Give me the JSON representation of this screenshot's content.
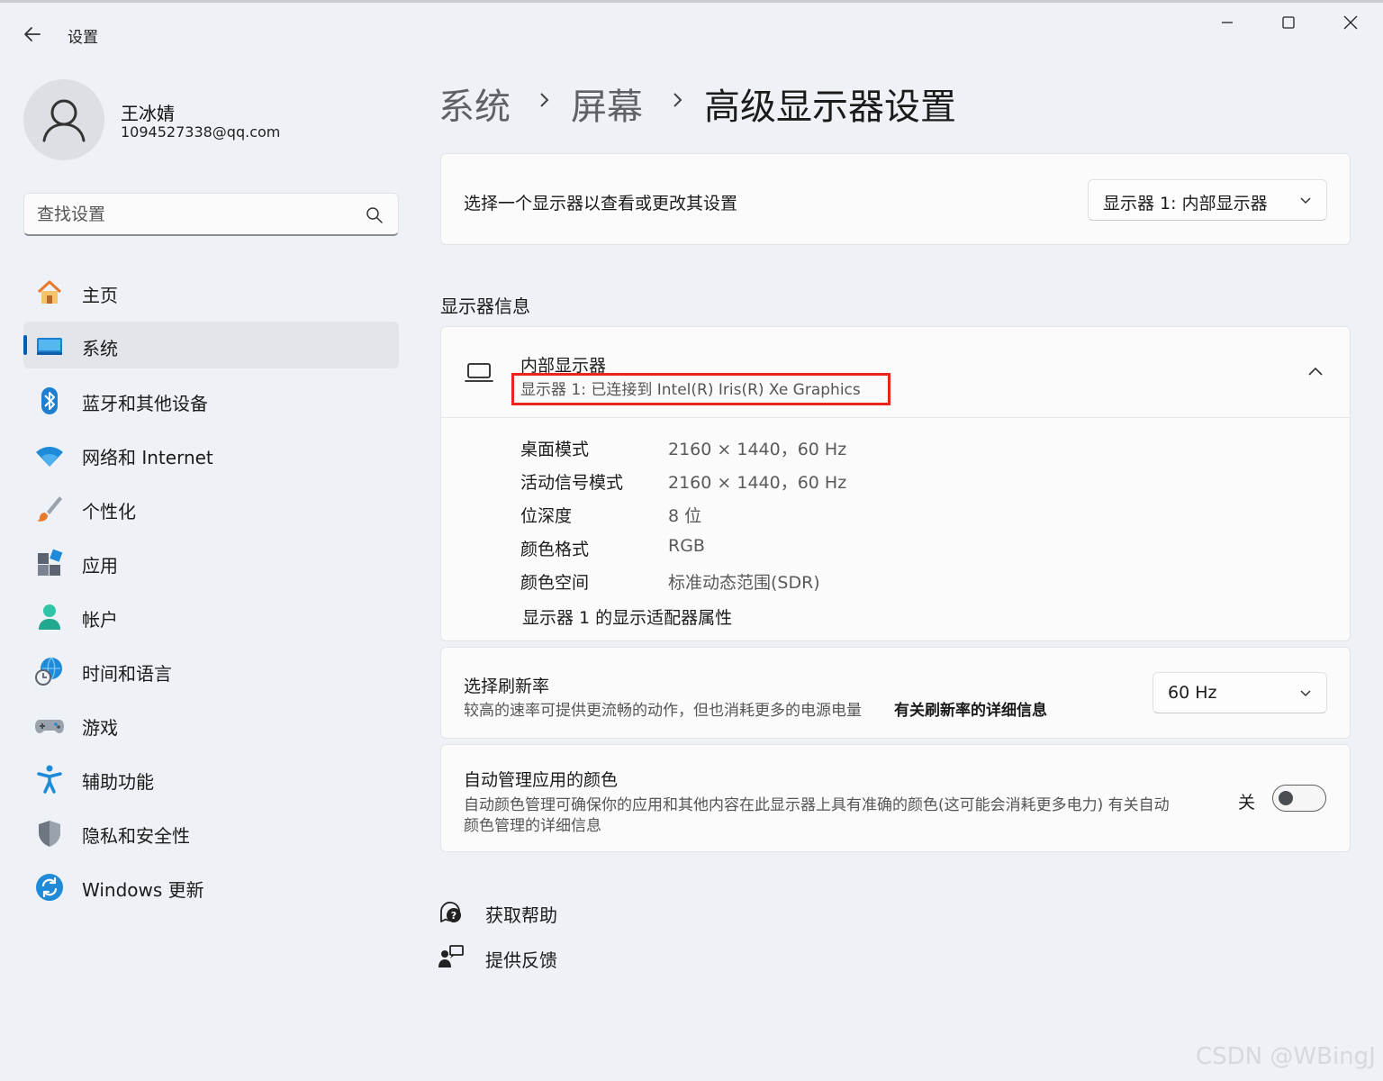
{
  "window": {
    "title": "设置"
  },
  "profile": {
    "name": "王冰婧",
    "email": "1094527338@qq.com"
  },
  "search": {
    "placeholder": "查找设置"
  },
  "sidebar": {
    "items": [
      {
        "label": "主页",
        "icon": "home-icon"
      },
      {
        "label": "系统",
        "icon": "system-icon",
        "active": true
      },
      {
        "label": "蓝牙和其他设备",
        "icon": "bluetooth-icon"
      },
      {
        "label": "网络和 Internet",
        "icon": "wifi-icon"
      },
      {
        "label": "个性化",
        "icon": "brush-icon"
      },
      {
        "label": "应用",
        "icon": "apps-icon"
      },
      {
        "label": "帐户",
        "icon": "account-icon"
      },
      {
        "label": "时间和语言",
        "icon": "globe-clock-icon"
      },
      {
        "label": "游戏",
        "icon": "gamepad-icon"
      },
      {
        "label": "辅助功能",
        "icon": "accessibility-icon"
      },
      {
        "label": "隐私和安全性",
        "icon": "shield-icon"
      },
      {
        "label": "Windows 更新",
        "icon": "update-icon"
      }
    ]
  },
  "breadcrumb": {
    "items": [
      "系统",
      "屏幕",
      "高级显示器设置"
    ]
  },
  "display_select": {
    "label": "选择一个显示器以查看或更改其设置",
    "value": "显示器 1: 内部显示器"
  },
  "display_info": {
    "section_title": "显示器信息",
    "name": "内部显示器",
    "subtitle": "显示器 1: 已连接到 Intel(R) Iris(R) Xe Graphics",
    "rows": [
      {
        "label": "桌面模式",
        "value": "2160 × 1440，60 Hz"
      },
      {
        "label": "活动信号模式",
        "value": "2160 × 1440，60 Hz"
      },
      {
        "label": "位深度",
        "value": "8 位"
      },
      {
        "label": "颜色格式",
        "value": "RGB"
      },
      {
        "label": "颜色空间",
        "value": "标准动态范围(SDR)"
      }
    ],
    "adapter_link": "显示器 1 的显示适配器属性"
  },
  "refresh_rate": {
    "title": "选择刷新率",
    "description": "较高的速率可提供更流畅的动作，但也消耗更多的电源电量",
    "link": "有关刷新率的详细信息",
    "value": "60 Hz"
  },
  "auto_color": {
    "title": "自动管理应用的颜色",
    "description_line1": "自动颜色管理可确保你的应用和其他内容在此显示器上具有准确的颜色(这可能会消耗更多电力) 有关自动",
    "description_line2": "颜色管理的详细信息",
    "state_label": "关",
    "enabled": false
  },
  "footer": {
    "help": "获取帮助",
    "feedback": "提供反馈"
  },
  "watermark": "CSDN @WBingJ",
  "colors": {
    "accent": "#005fb8",
    "highlight_box": "#e8261e",
    "background": "#eef1f6",
    "card": "#fbfbfc"
  }
}
